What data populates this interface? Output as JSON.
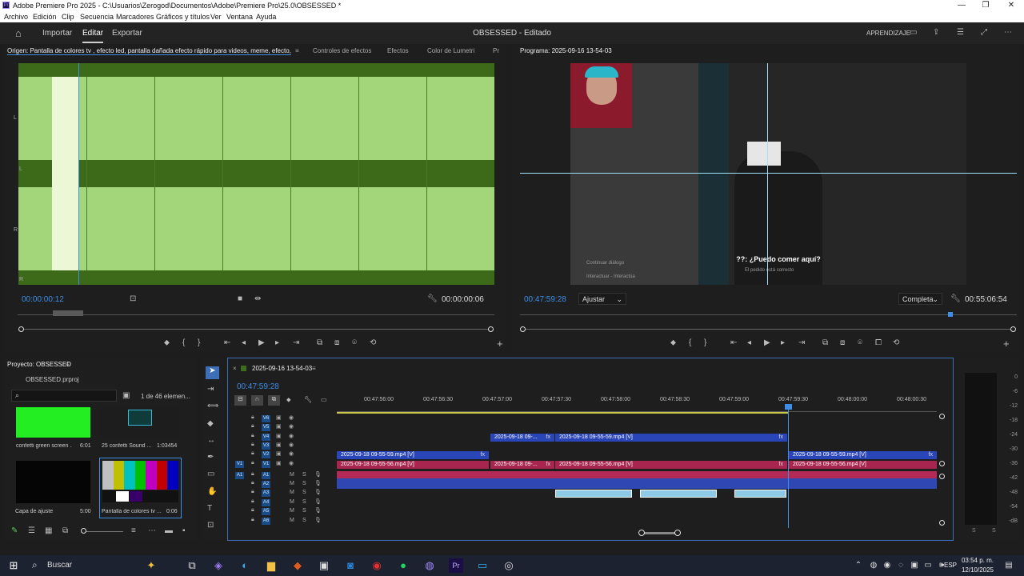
{
  "window": {
    "title": "Adobe Premiere Pro 2025 - C:\\Usuarios\\Zerogod\\Documentos\\Adobe\\Premiere Pro\\25.0\\OBSESSED *",
    "logo": "Pr"
  },
  "menu": [
    "Archivo",
    "Edición",
    "Clip",
    "Secuencia",
    "Marcadores",
    "Gráficos y títulos",
    "Ver",
    "Ventana",
    "Ayuda"
  ],
  "header": {
    "workspaces": [
      "Importar",
      "Editar",
      "Exportar"
    ],
    "active": "Editar",
    "doc_title": "OBSESSED - Editado",
    "learning": "APRENDIZAJE"
  },
  "source": {
    "tab": "Origen: Pantalla de colores tv , efecto led, pantalla dañada efecto rápido para videos, meme, efecto, daño.mp4",
    "tabs": [
      "Controles de efectos",
      "Efectos",
      "Color de Lumetri",
      "Pr"
    ],
    "channel_labels": [
      "L",
      "L",
      "R",
      "R"
    ],
    "timecode": "00:00:00:12",
    "duration": "00:00:00:06"
  },
  "program": {
    "tab": "Programa: 2025-09-16 13-54-03",
    "subtitle": "??: ¿Puedo comer aquí?",
    "hint1": "Continuar diálogo",
    "hint2": "Interactuar - Interactúa",
    "hint3": "El pedido está correcto",
    "timecode": "00:47:59:28",
    "fit": "Ajustar",
    "quality": "Completa",
    "duration": "00:55:06:54"
  },
  "project": {
    "title": "Proyecto: OBSESSED",
    "file": "OBSESSED.prproj",
    "count": "1 de 46 elemen...",
    "items": [
      {
        "name": "confetti green screen ...",
        "dur": "6:01"
      },
      {
        "name": "25 confetti Sound ...",
        "dur": "1:03454"
      },
      {
        "name": "Capa de ajuste",
        "dur": "5:00"
      },
      {
        "name": "Pantalla de colores tv ...",
        "dur": "0:06"
      }
    ]
  },
  "timeline": {
    "tab": "2025-09-16 13-54-03",
    "timecode": "00:47:59:28",
    "ruler": [
      "00:47:56:00",
      "00:47:56:30",
      "00:47:57:00",
      "00:47:57:30",
      "00:47:58:00",
      "00:47:58:30",
      "00:47:59:00",
      "00:47:59:30",
      "00:48:00:00",
      "00:48:00:30"
    ],
    "video_tracks": [
      "V6",
      "V5",
      "V4",
      "V3",
      "V2",
      "V1"
    ],
    "audio_tracks": [
      "A1",
      "A2",
      "A3",
      "A4",
      "A5",
      "A6"
    ],
    "src_v": "V1",
    "src_a": "A1",
    "mute_label": "M",
    "solo_label": "S",
    "fx": "fx",
    "clips": {
      "v4_a": "2025-09-18 09-...",
      "v4_b": "2025-09-18 09-55-59.mp4 [V]",
      "v2_a": "2025-09-18 09-55-59.mp4 [V]",
      "v2_b": "2025-09-18 09-55-59.mp4 [V]",
      "v1_a": "2025-09-18 09-55-56.mp4 [V]",
      "v1_b": "2025-09-18 09-...",
      "v1_c": "2025-09-18 09-55-56.mp4 [V]",
      "v1_d": "2025-09-18 09-55-56.mp4 [V]"
    }
  },
  "meter": {
    "scale": [
      "0",
      "-6",
      "-12",
      "-18",
      "-24",
      "-30",
      "-36",
      "-42",
      "-48",
      "-54",
      "-dB"
    ],
    "footer": [
      "S",
      "S"
    ]
  },
  "taskbar": {
    "search": "Buscar",
    "lang": "ESP",
    "time": "03:54 p. m.",
    "date": "12/10/2025"
  },
  "colors": {
    "accent": "#3d8ee6",
    "wave_bg": "#3d6a18",
    "wave": "#a3d67a",
    "video_clip": "#2945b8",
    "linked_clip": "#a8254f"
  }
}
